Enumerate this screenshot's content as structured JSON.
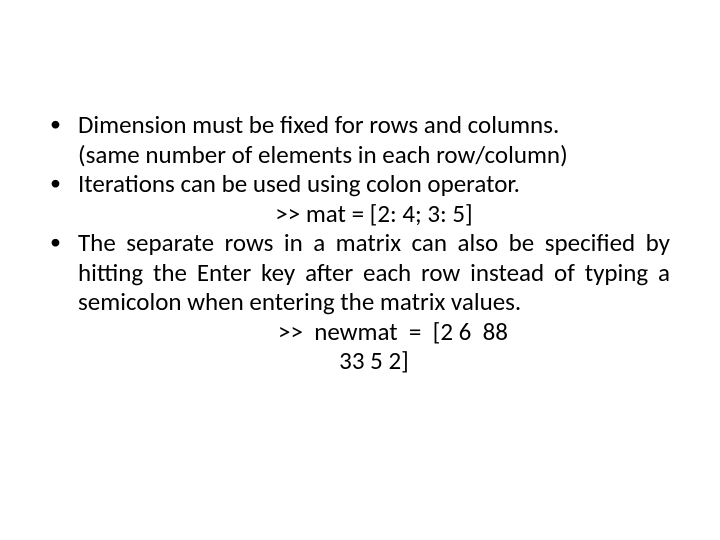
{
  "bullets": {
    "b1": {
      "line1": "Dimension must be fixed for rows and columns.",
      "line2": "(same number of elements in each row/column)"
    },
    "b2": {
      "line1": "Iterations can be used using colon operator.",
      "code": ">>  mat   =  [2: 4; 3: 5]"
    },
    "b3": {
      "text": "The separate rows in a matrix can also be specified by hitting the Enter key after each row instead of typing a semicolon when entering the matrix values.",
      "code1": ">>  newmat  =  [2 6  88",
      "code2": "33   5   2]"
    }
  }
}
